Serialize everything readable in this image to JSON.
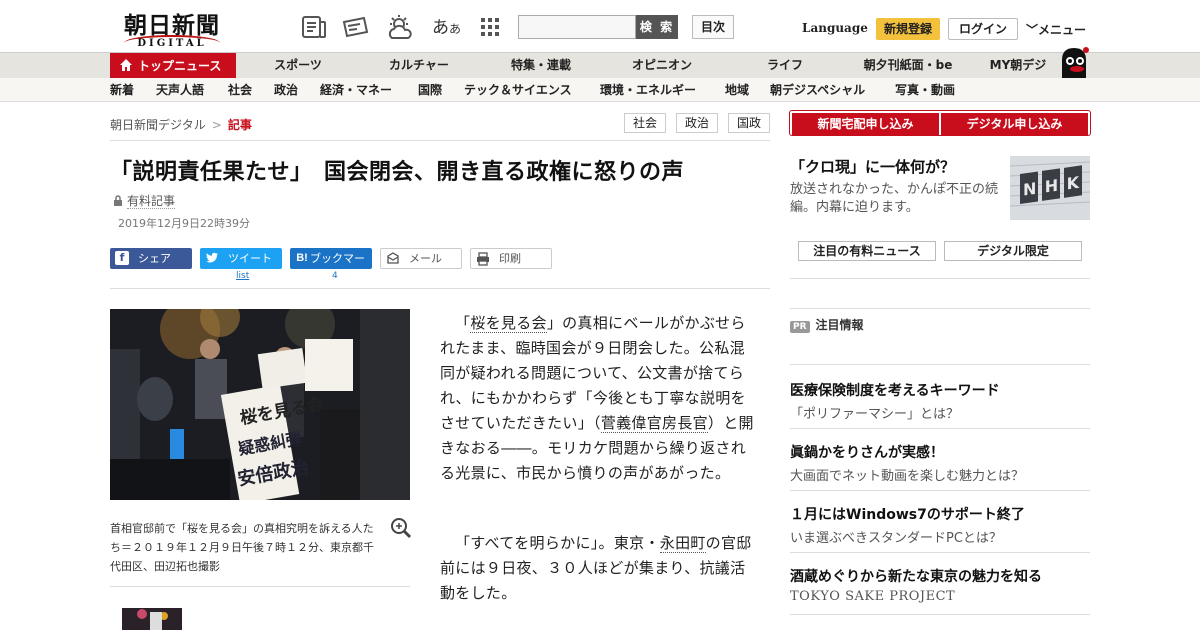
{
  "header": {
    "logo_main": "朝日新聞",
    "logo_sub": "DIGITAL",
    "font_size_label": "あ",
    "font_size_small": "あ",
    "search_button": "検 索",
    "search_placeholder": "",
    "toc_button": "目次",
    "language": "Language",
    "register": "新規登録",
    "login": "ログイン",
    "menu": "メニュー"
  },
  "nav_primary": [
    {
      "label": "トップニュース"
    },
    {
      "label": "スポーツ"
    },
    {
      "label": "カルチャー"
    },
    {
      "label": "特集・連載"
    },
    {
      "label": "オピニオン"
    },
    {
      "label": "ライフ"
    },
    {
      "label": "朝夕刊紙面・be"
    },
    {
      "label": "MY朝デジ"
    }
  ],
  "nav_secondary": [
    "新着",
    "天声人語",
    "社会",
    "政治",
    "経済・マネー",
    "国際",
    "テック＆サイエンス",
    "環境・エネルギー",
    "地域",
    "朝デジスペシャル",
    "写真・動画"
  ],
  "breadcrumb": {
    "root": "朝日新聞デジタル",
    "sep": ">",
    "current": "記事"
  },
  "tags": [
    "社会",
    "政治",
    "国政"
  ],
  "article": {
    "title": "「説明責任果たせ」　国会閉会、開き直る政権に怒りの声",
    "paid_label": "有料記事",
    "date": "2019年12月9日22時39分",
    "share": {
      "facebook": "シェア",
      "tweet": "ツイート",
      "tweet_count": "list",
      "bookmark": "ブックマーク",
      "bookmark_count": "4",
      "mail": "メール",
      "print": "印刷"
    },
    "caption": "首相官邸前で「桜を見る会」の真相究明を訴える人たち＝２０１９年１２月９日午後７時１２分、東京都千代田区、田辺拓也撮影",
    "photo_signs": [
      "桜を見る会",
      "疑惑糾弾",
      "安倍政治"
    ],
    "p1": {
      "a": "「",
      "link1": "桜を見る会",
      "b": "」の真相にベールがかぶせられたまま、臨時国会が９日閉会した。公私混同が疑われる問題について、公文書が捨てられ、にもかかわらず「今後とも丁寧な説明をさせていただきたい」（",
      "link2": "菅義偉官房長官",
      "c": "）と開きなおる――。モリカケ問題から繰り返される光景に、市民から憤りの声があがった。"
    },
    "p2": {
      "a": "「すべてを明らかに」。東京・",
      "link1": "永田町",
      "b": "の官邸前には９日夜、３０人ほどが集まり、抗議活動をした。"
    }
  },
  "sidebar": {
    "subscribe_paper": "新聞宅配申し込み",
    "subscribe_digital": "デジタル申し込み",
    "feature_title": "「クロ現」に一体何が？",
    "feature_desc": "放送されなかった、かんぽ不正の続編。内幕に迫ります。",
    "feature_img_text": "NHK",
    "tab_paid_news": "注目の有料ニュース",
    "tab_digital_only": "デジタル限定",
    "pr_badge": "PR",
    "pr_heading": "注目情報",
    "ads": [
      {
        "title": "医療保険制度を考えるキーワード",
        "sub": "「ポリファーマシー」とは？"
      },
      {
        "title": "眞鍋かをりさんが実感！",
        "sub": "大画面でネット動画を楽しむ魅力とは？"
      },
      {
        "title": "１月にはWindows7のサポート終了",
        "sub": "いま選ぶべきスタンダードPCとは？"
      },
      {
        "title": "酒蔵めぐりから新たな東京の魅力を知る",
        "sub": "TOKYO SAKE PROJECT"
      }
    ]
  },
  "colors": {
    "brand_red": "#c80e1c",
    "register_yellow": "#f4c13d",
    "facebook": "#3b5998",
    "twitter": "#1da1f2",
    "hatena": "#1a73c6"
  }
}
